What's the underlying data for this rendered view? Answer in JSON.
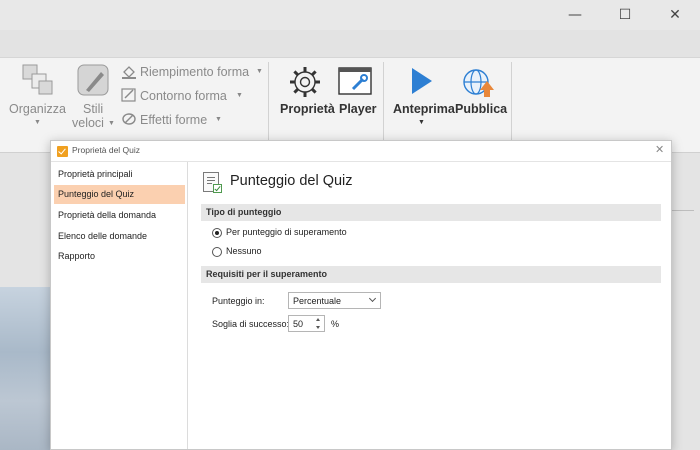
{
  "window": {
    "minimize_glyph": "—",
    "maximize_glyph": "☐",
    "close_glyph": "✕"
  },
  "ribbon": {
    "organizza": "Organizza",
    "stili_veloci": [
      "Stili",
      "veloci"
    ],
    "riempimento": "Riempimento forma",
    "contorno": "Contorno forma",
    "effetti": "Effetti forme",
    "proprieta": "Proprietà",
    "player": "Player",
    "anteprima": "Anteprima",
    "pubblica": "Pubblica",
    "dropdown_glyph": "▼"
  },
  "dialog": {
    "title": "Proprietà del Quiz",
    "close_glyph": "✕",
    "nav": [
      "Proprietà principali",
      "Punteggio del Quiz",
      "Proprietà della domanda",
      "Elenco delle domande",
      "Rapporto"
    ],
    "active_nav_index": 1,
    "page_title": "Punteggio del Quiz",
    "scoring_section": {
      "title": "Tipo di punteggio",
      "options": [
        "Per punteggio di superamento",
        "Nessuno"
      ],
      "selected": "Per punteggio di superamento"
    },
    "requirements_section": {
      "title": "Requisiti per il superamento",
      "score_label": "Punteggio in:",
      "score_value": "Percentuale",
      "threshold_label": "Soglia di successo:",
      "threshold_value": "50",
      "threshold_unit": "%"
    }
  },
  "colors": {
    "active_nav": "#fbd0b0",
    "accent_orange": "#f0a020",
    "play_blue": "#2d7fd3"
  }
}
